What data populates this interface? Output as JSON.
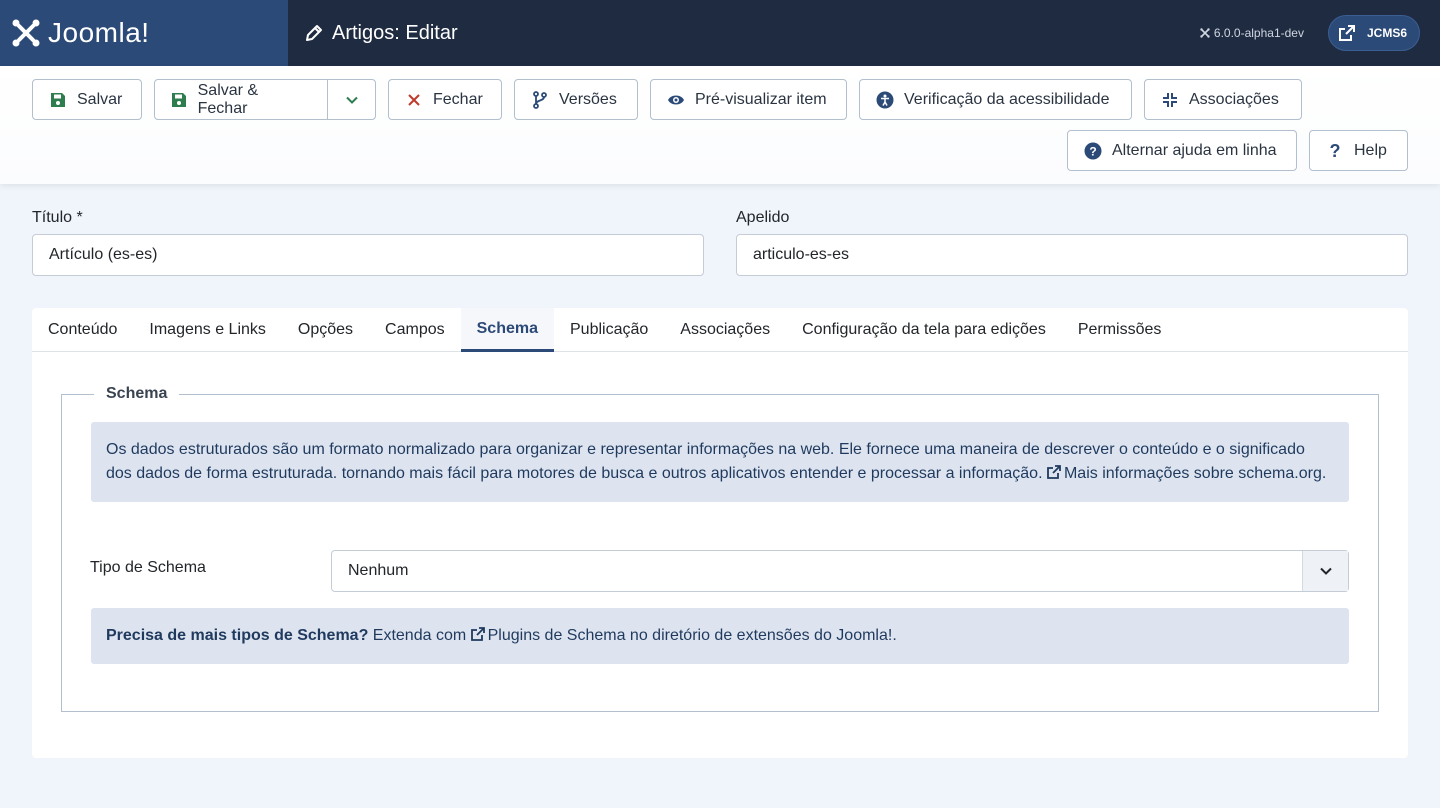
{
  "header": {
    "brand": "Joomla!",
    "title": "Artigos: Editar",
    "version": "6.0.0-alpha1-dev",
    "site_label": "JCMS6"
  },
  "toolbar": {
    "save": "Salvar",
    "save_close": "Salvar & Fechar",
    "close": "Fechar",
    "versions": "Versões",
    "preview": "Pré-visualizar item",
    "accessibility": "Verificação da acessibilidade",
    "associations": "Associações",
    "toggle_help": "Alternar ajuda em linha",
    "help": "Help"
  },
  "form": {
    "title_label": "Título *",
    "title_value": "Artículo (es-es)",
    "alias_label": "Apelido",
    "alias_value": "articulo-es-es"
  },
  "tabs": [
    {
      "label": "Conteúdo"
    },
    {
      "label": "Imagens e Links"
    },
    {
      "label": "Opções"
    },
    {
      "label": "Campos"
    },
    {
      "label": "Schema"
    },
    {
      "label": "Publicação"
    },
    {
      "label": "Associações"
    },
    {
      "label": "Configuração da tela para edições"
    },
    {
      "label": "Permissões"
    }
  ],
  "schema": {
    "legend": "Schema",
    "info_text": "Os dados estruturados são um formato normalizado para organizar e representar informações na web. Ele fornece uma maneira de descrever o conteúdo e o significado dos dados de forma estruturada. tornando mais fácil para motores de busca e outros aplicativos entender e processar a informação.",
    "info_link": "Mais informações sobre schema.org.",
    "type_label": "Tipo de Schema",
    "type_value": "Nenhum",
    "more_bold": "Precisa de mais tipos de Schema?",
    "more_text": " Extenda com ",
    "more_link": "Plugins de Schema no diretório de extensões do Joomla!."
  },
  "colors": {
    "header_bg": "#1f2b41",
    "brand_bg": "#2c4a77",
    "accent": "#2c4a77",
    "save_icon": "#2e7d4f",
    "close_icon": "#c0392b",
    "alert_bg": "#dde4ef"
  }
}
